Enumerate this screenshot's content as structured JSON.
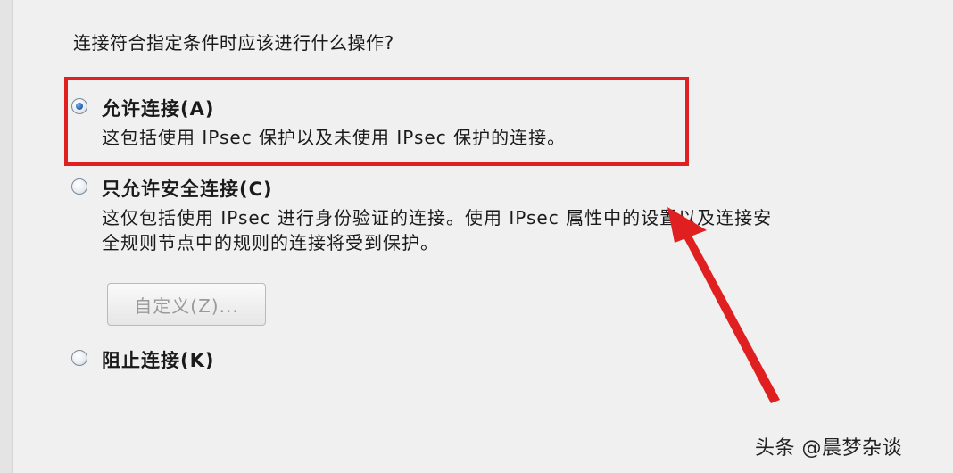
{
  "question": "连接符合指定条件时应该进行什么操作?",
  "options": [
    {
      "label": "允许连接(A)",
      "description": [
        "这包括使用 IPsec 保护以及未使用 IPsec 保护的连接。"
      ],
      "selected": true
    },
    {
      "label": "只允许安全连接(C)",
      "description": [
        "这仅包括使用 IPsec 进行身份验证的连接。使用 IPsec 属性中的设置以及连接安",
        "全规则节点中的规则的连接将受到保护。"
      ],
      "selected": false
    },
    {
      "label": "阻止连接(K)",
      "selected": false
    }
  ],
  "custom_button_label": "自定义(Z)...",
  "watermark": "头条 @晨梦杂谈",
  "colors": {
    "highlight": "#e02020",
    "arrow": "#e02020",
    "background": "#f0f0f0"
  }
}
